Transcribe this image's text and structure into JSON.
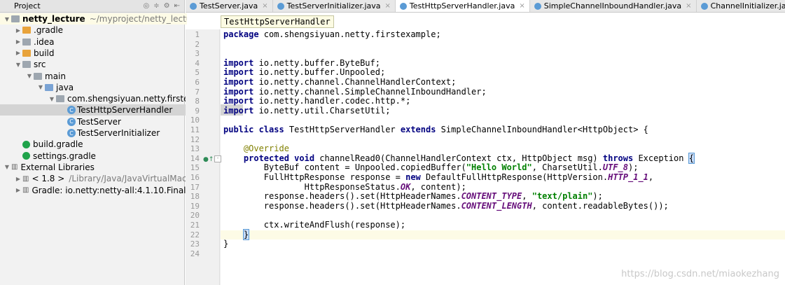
{
  "project_panel": {
    "title": "Project",
    "rows": [
      {
        "label": "netty_lecture",
        "extra": "~/myproject/netty_lecture",
        "depth": 0,
        "arrow": "▼",
        "icon": "folder-gray",
        "bold": true
      },
      {
        "label": ".gradle",
        "depth": 1,
        "arrow": "▶",
        "icon": "folder-orange"
      },
      {
        "label": ".idea",
        "depth": 1,
        "arrow": "▶",
        "icon": "folder-gray"
      },
      {
        "label": "build",
        "depth": 1,
        "arrow": "▶",
        "icon": "folder-orange"
      },
      {
        "label": "src",
        "depth": 1,
        "arrow": "▼",
        "icon": "folder-gray"
      },
      {
        "label": "main",
        "depth": 2,
        "arrow": "▼",
        "icon": "folder-gray"
      },
      {
        "label": "java",
        "depth": 3,
        "arrow": "▼",
        "icon": "folder-blue"
      },
      {
        "label": "com.shengsiyuan.netty.firstexa",
        "depth": 4,
        "arrow": "▼",
        "icon": "folder-gray"
      },
      {
        "label": "TestHttpServerHandler",
        "depth": 5,
        "arrow": "",
        "icon": "class",
        "selected": true
      },
      {
        "label": "TestServer",
        "depth": 5,
        "arrow": "",
        "icon": "class"
      },
      {
        "label": "TestServerInitializer",
        "depth": 5,
        "arrow": "",
        "icon": "class"
      },
      {
        "label": "build.gradle",
        "depth": 1,
        "arrow": "",
        "icon": "gradle"
      },
      {
        "label": "settings.gradle",
        "depth": 1,
        "arrow": "",
        "icon": "gradle"
      },
      {
        "label": "External Libraries",
        "depth": 0,
        "arrow": "▼",
        "icon": "library"
      },
      {
        "label": "< 1.8 >",
        "extra": "/Library/Java/JavaVirtualMachine",
        "depth": 1,
        "arrow": "▶",
        "icon": "library"
      },
      {
        "label": "Gradle: io.netty:netty-all:4.1.10.Final",
        "depth": 1,
        "arrow": "▶",
        "icon": "library"
      }
    ]
  },
  "tabs": [
    {
      "label": "TestServer.java",
      "active": false
    },
    {
      "label": "TestServerInitializer.java",
      "active": false
    },
    {
      "label": "TestHttpServerHandler.java",
      "active": true
    },
    {
      "label": "SimpleChannelInboundHandler.java",
      "active": false
    },
    {
      "label": "ChannelInitializer.java",
      "active": false
    }
  ],
  "breadcrumb": "TestHttpServerHandler",
  "editor": {
    "current_line": 22,
    "lines": [
      {
        "n": "1",
        "html": "<span class=\"kw\">package</span> com.shengsiyuan.netty.firstexample;"
      },
      {
        "n": "2",
        "html": ""
      },
      {
        "n": "3",
        "html": ""
      },
      {
        "n": "4",
        "html": "<span class=\"kw\">import</span> io.netty.buffer.ByteBuf;"
      },
      {
        "n": "5",
        "html": "<span class=\"kw\">import</span> io.netty.buffer.Unpooled;"
      },
      {
        "n": "6",
        "html": "<span class=\"kw\">import</span> io.netty.channel.ChannelHandlerContext;"
      },
      {
        "n": "7",
        "html": "<span class=\"kw\">import</span> io.netty.channel.SimpleChannelInboundHandler;"
      },
      {
        "n": "8",
        "html": "<span class=\"kw\">import</span> io.netty.handler.codec.http.*;"
      },
      {
        "n": "9",
        "html": "<span class=\"kw\">import</span> io.netty.util.CharsetUtil;"
      },
      {
        "n": "10",
        "html": ""
      },
      {
        "n": "11",
        "html": "<span class=\"kw\">public class</span> TestHttpServerHandler <span class=\"kw\">extends</span> SimpleChannelInboundHandler&lt;HttpObject&gt; {"
      },
      {
        "n": "12",
        "html": ""
      },
      {
        "n": "13",
        "html": "    <span class=\"anno\">@Override</span>"
      },
      {
        "n": "14",
        "html": "    <span class=\"kw\">protected void</span> channelRead0(ChannelHandlerContext ctx, HttpObject msg) <span class=\"kw\">throws</span> Exception <span class=\"brace-match\">{</span>"
      },
      {
        "n": "15",
        "html": "        ByteBuf content = Unpooled.copiedBuffer(<span class=\"str\">\"Hello World\"</span>, CharsetUtil.<span class=\"konst\">UTF_8</span>);"
      },
      {
        "n": "16",
        "html": "        FullHttpResponse response = <span class=\"kw\">new</span> DefaultFullHttpResponse(HttpVersion.<span class=\"konst\">HTTP_1_1</span>,"
      },
      {
        "n": "17",
        "html": "                HttpResponseStatus.<span class=\"konst\">OK</span>, content);"
      },
      {
        "n": "18",
        "html": "        response.headers().set(HttpHeaderNames.<span class=\"konst\">CONTENT_TYPE</span>, <span class=\"str\">\"text/plain\"</span>);"
      },
      {
        "n": "19",
        "html": "        response.headers().set(HttpHeaderNames.<span class=\"konst\">CONTENT_LENGTH</span>, content.readableBytes());"
      },
      {
        "n": "20",
        "html": ""
      },
      {
        "n": "21",
        "html": "        ctx.writeAndFlush(response);"
      },
      {
        "n": "22",
        "html": "    <span class=\"brace-match\">}</span>"
      },
      {
        "n": "23",
        "html": "}"
      },
      {
        "n": "24",
        "html": ""
      }
    ]
  },
  "watermark": "https://blog.csdn.net/miaokezhang"
}
